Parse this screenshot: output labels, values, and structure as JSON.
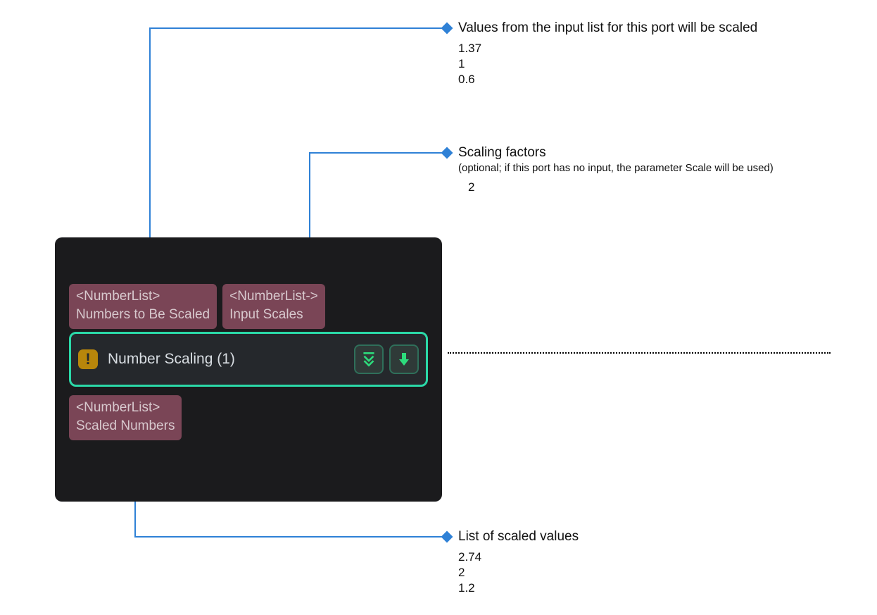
{
  "node": {
    "title": "Number Scaling (1)",
    "inputs": [
      {
        "type": "<NumberList>",
        "label": "Numbers to Be Scaled"
      },
      {
        "type": "<NumberList->",
        "label": "Input Scales"
      }
    ],
    "outputs": [
      {
        "type": "<NumberList>",
        "label": "Scaled Numbers"
      }
    ]
  },
  "annotations": {
    "input_values": {
      "title": "Values from the input list for this port will be scaled",
      "values": [
        "1.37",
        "1",
        "0.6"
      ]
    },
    "scales": {
      "title": "Scaling factors",
      "subtitle": "(optional; if this port has no input, the parameter Scale will be used)",
      "values": [
        "2"
      ]
    },
    "output_values": {
      "title": "List of scaled values",
      "values": [
        "2.74",
        "2",
        "1.2"
      ]
    }
  },
  "colors": {
    "connector": "#2f81d6",
    "node_bg": "#1b1b1d",
    "port_bg": "#7a4556",
    "accent": "#2bd9a8"
  }
}
